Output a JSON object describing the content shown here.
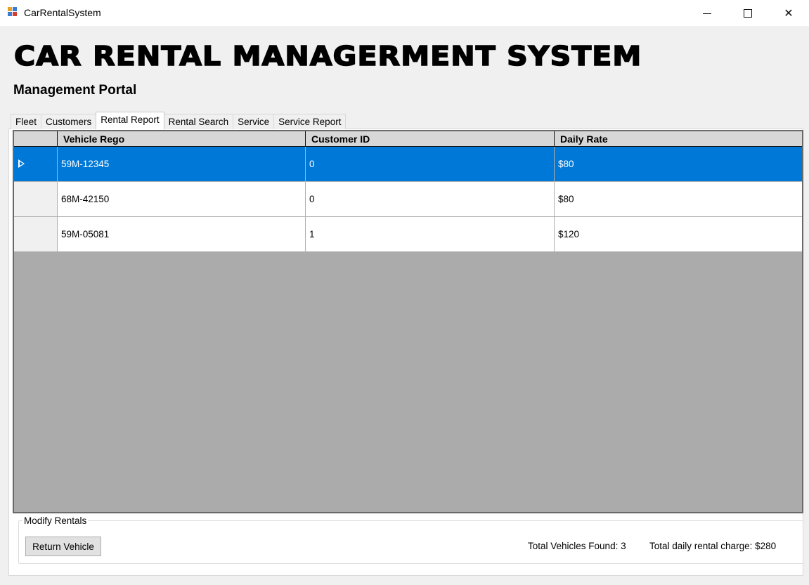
{
  "window": {
    "title": "CarRentalSystem",
    "controls": [
      "minimize-icon",
      "maximize-icon",
      "close-icon"
    ]
  },
  "header": {
    "title": "CAR RENTAL MANAGERMENT SYSTEM",
    "subtitle": "Management Portal"
  },
  "tabs": [
    {
      "label": "Fleet",
      "active": false
    },
    {
      "label": "Customers",
      "active": false
    },
    {
      "label": "Rental Report",
      "active": true
    },
    {
      "label": "Rental Search",
      "active": false
    },
    {
      "label": "Service",
      "active": false
    },
    {
      "label": "Service Report",
      "active": false
    }
  ],
  "grid": {
    "columns": [
      "Vehicle Rego",
      "Customer ID",
      "Daily Rate"
    ],
    "rows": [
      {
        "rego": "59M-12345",
        "customer_id": "0",
        "daily_rate": "$80",
        "selected": true
      },
      {
        "rego": "68M-42150",
        "customer_id": "0",
        "daily_rate": "$80",
        "selected": false
      },
      {
        "rego": "59M-05081",
        "customer_id": "1",
        "daily_rate": "$120",
        "selected": false
      }
    ],
    "selection_color": "#0078d7",
    "empty_area_color": "#ababab"
  },
  "modify": {
    "legend": "Modify Rentals",
    "return_label": "Return Vehicle",
    "total_vehicles": "Total Vehicles Found: 3",
    "total_charge": "Total daily rental charge: $280"
  }
}
